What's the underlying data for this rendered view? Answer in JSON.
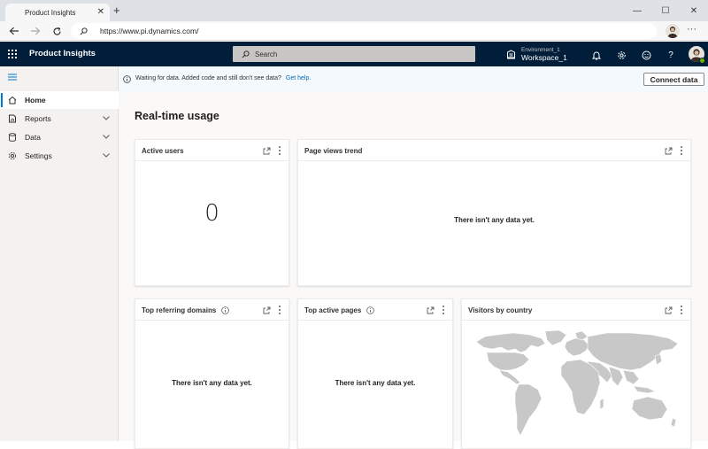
{
  "browser": {
    "tab_title": "Product Insights",
    "tab_close": "✕",
    "new_tab": "+",
    "url": "https://www.pi.dynamics.com/",
    "minimize": "—",
    "maximize": "☐",
    "close": "✕",
    "more": "···"
  },
  "appbar": {
    "title": "Product Insights",
    "search_placeholder": "Search",
    "environment_label": "Environment_1",
    "workspace": "Workspace_1",
    "help": "?"
  },
  "sidebar": {
    "items": [
      {
        "label": "Home",
        "icon": "home-icon",
        "active": true
      },
      {
        "label": "Reports",
        "icon": "report-icon",
        "expandable": true
      },
      {
        "label": "Data",
        "icon": "database-icon",
        "expandable": true
      },
      {
        "label": "Settings",
        "icon": "gear-icon",
        "expandable": true
      }
    ]
  },
  "banner": {
    "text": "Waiting for data. Added code and still don't see data?",
    "link": "Get help.",
    "button": "Connect data"
  },
  "page": {
    "title": "Real-time usage"
  },
  "cards": {
    "active_users": {
      "title": "Active users",
      "value": "0"
    },
    "page_views": {
      "title": "Page views trend",
      "empty": "There isn't any data yet."
    },
    "referring_domains": {
      "title": "Top referring domains",
      "empty": "There isn't any data yet."
    },
    "active_pages": {
      "title": "Top active pages",
      "empty": "There isn't any data yet."
    },
    "visitors": {
      "title": "Visitors by country"
    }
  },
  "colors": {
    "appbar": "#001d39",
    "accent": "#0078d4",
    "link": "#0067b8",
    "map_land": "#c8c8c8"
  }
}
